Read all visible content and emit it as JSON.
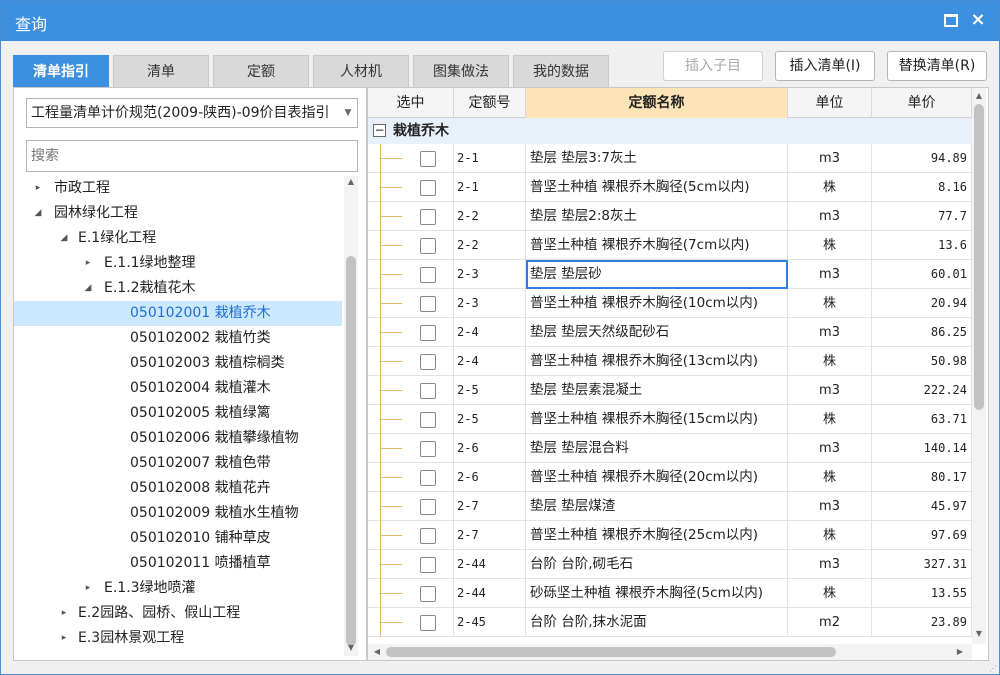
{
  "window": {
    "title": "查询",
    "minimize_icon": "restore-icon",
    "close_label": "×"
  },
  "tabs": [
    {
      "label": "清单指引",
      "active": true
    },
    {
      "label": "清单",
      "active": false
    },
    {
      "label": "定额",
      "active": false
    },
    {
      "label": "人材机",
      "active": false
    },
    {
      "label": "图集做法",
      "active": false
    },
    {
      "label": "我的数据",
      "active": false
    }
  ],
  "actions": {
    "insert_child": "插入子目",
    "insert_list": "插入清单(I)",
    "replace_list": "替换清单(R)"
  },
  "left": {
    "combo_value": "工程量清单计价规范(2009-陕西)-09价目表指引",
    "search_placeholder": "搜索",
    "tree": [
      {
        "label": "市政工程",
        "arrow": "▸"
      },
      {
        "label": "园林绿化工程",
        "arrow": "◢"
      },
      {
        "label": "E.1绿化工程",
        "arrow": "◢"
      },
      {
        "label": "E.1.1绿地整理",
        "arrow": "▸"
      },
      {
        "label": "E.1.2栽植花木",
        "arrow": "◢"
      },
      {
        "label": "050102001  栽植乔木",
        "arrow": ""
      },
      {
        "label": "050102002  栽植竹类",
        "arrow": ""
      },
      {
        "label": "050102003  栽植棕榈类",
        "arrow": ""
      },
      {
        "label": "050102004  栽植灌木",
        "arrow": ""
      },
      {
        "label": "050102005  栽植绿篱",
        "arrow": ""
      },
      {
        "label": "050102006  栽植攀缘植物",
        "arrow": ""
      },
      {
        "label": "050102007  栽植色带",
        "arrow": ""
      },
      {
        "label": "050102008  栽植花卉",
        "arrow": ""
      },
      {
        "label": "050102009  栽植水生植物",
        "arrow": ""
      },
      {
        "label": "050102010  铺种草皮",
        "arrow": ""
      },
      {
        "label": "050102011  喷播植草",
        "arrow": ""
      },
      {
        "label": "E.1.3绿地喷灌",
        "arrow": "▸"
      },
      {
        "label": "E.2园路、园桥、假山工程",
        "arrow": "▸"
      },
      {
        "label": "E.3园林景观工程",
        "arrow": "▸"
      }
    ]
  },
  "table": {
    "headers": {
      "select": "选中",
      "code": "定额号",
      "name": "定额名称",
      "unit": "单位",
      "price": "单价"
    },
    "group": {
      "toggle": "−",
      "label": "栽植乔木"
    },
    "rows": [
      {
        "code": "2-1",
        "name": "垫层 垫层3:7灰土",
        "unit": "m3",
        "price": "94.89"
      },
      {
        "code": "2-1",
        "name": "普坚土种植 裸根乔木胸径(5cm以内)",
        "unit": "株",
        "price": "8.16"
      },
      {
        "code": "2-2",
        "name": "垫层 垫层2:8灰土",
        "unit": "m3",
        "price": "77.7"
      },
      {
        "code": "2-2",
        "name": "普坚土种植 裸根乔木胸径(7cm以内)",
        "unit": "株",
        "price": "13.6"
      },
      {
        "code": "2-3",
        "name": "垫层 垫层砂",
        "unit": "m3",
        "price": "60.01"
      },
      {
        "code": "2-3",
        "name": "普坚土种植 裸根乔木胸径(10cm以内)",
        "unit": "株",
        "price": "20.94"
      },
      {
        "code": "2-4",
        "name": "垫层 垫层天然级配砂石",
        "unit": "m3",
        "price": "86.25"
      },
      {
        "code": "2-4",
        "name": "普坚土种植 裸根乔木胸径(13cm以内)",
        "unit": "株",
        "price": "50.98"
      },
      {
        "code": "2-5",
        "name": "垫层 垫层素混凝土",
        "unit": "m3",
        "price": "222.24"
      },
      {
        "code": "2-5",
        "name": "普坚土种植 裸根乔木胸径(15cm以内)",
        "unit": "株",
        "price": "63.71"
      },
      {
        "code": "2-6",
        "name": "垫层 垫层混合料",
        "unit": "m3",
        "price": "140.14"
      },
      {
        "code": "2-6",
        "name": "普坚土种植 裸根乔木胸径(20cm以内)",
        "unit": "株",
        "price": "80.17"
      },
      {
        "code": "2-7",
        "name": "垫层 垫层煤渣",
        "unit": "m3",
        "price": "45.97"
      },
      {
        "code": "2-7",
        "name": "普坚土种植 裸根乔木胸径(25cm以内)",
        "unit": "株",
        "price": "97.69"
      },
      {
        "code": "2-44",
        "name": "台阶 台阶,砌毛石",
        "unit": "m3",
        "price": "327.31"
      },
      {
        "code": "2-44",
        "name": "砂砾坚土种植 裸根乔木胸径(5cm以内)",
        "unit": "株",
        "price": "13.55"
      },
      {
        "code": "2-45",
        "name": "台阶 台阶,抹水泥面",
        "unit": "m2",
        "price": "23.89"
      }
    ]
  },
  "colors": {
    "accent": "#3d8fe0",
    "selected_row": "#cce8ff",
    "header_highlight": "#fce4b6"
  }
}
